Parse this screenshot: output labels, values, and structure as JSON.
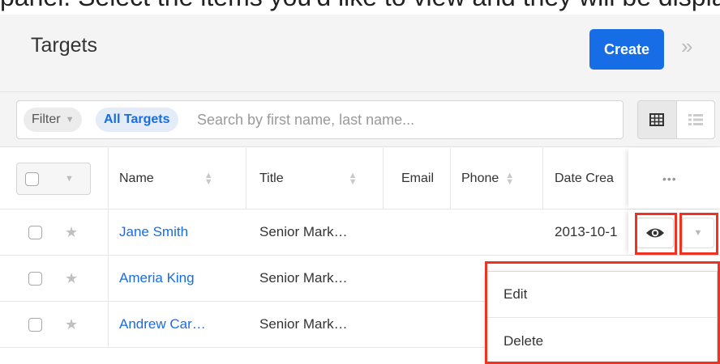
{
  "top_text": "panel. Select the items you'd like to view and they will be displayed directly in the",
  "header": {
    "title": "Targets",
    "create_label": "Create"
  },
  "filter": {
    "filter_label": "Filter",
    "module_pill": "All Targets",
    "search_placeholder": "Search by first name, last name..."
  },
  "table": {
    "columns": [
      "Name",
      "Title",
      "Email",
      "Phone",
      "Date Crea"
    ],
    "more_label": "•••",
    "rows": [
      {
        "name": "Jane Smith",
        "title": "Senior Mark…",
        "email": "",
        "phone": "",
        "date": "2013-10-1"
      },
      {
        "name": "Ameria King",
        "title": "Senior Mark…",
        "email": "",
        "phone": "",
        "date": ""
      },
      {
        "name": "Andrew Car…",
        "title": "Senior Mark…",
        "email": "",
        "phone": "",
        "date": ""
      }
    ]
  },
  "row_menu": {
    "items": [
      "Edit",
      "Delete"
    ]
  },
  "colors": {
    "accent": "#176de5",
    "highlight": "#ee3323"
  }
}
